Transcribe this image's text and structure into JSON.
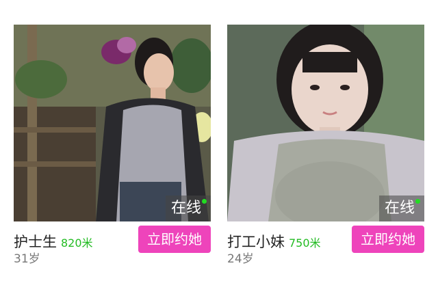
{
  "cards": [
    {
      "name": "护士生",
      "distance": "820米",
      "age": "31岁",
      "status": "在线",
      "action_label": "立即约她"
    },
    {
      "name": "打工小妹",
      "distance": "750米",
      "age": "24岁",
      "status": "在线",
      "action_label": "立即约她"
    }
  ],
  "colors": {
    "accent": "#ee44bb",
    "distance": "#22bb22",
    "online_dot": "#22dd22"
  }
}
